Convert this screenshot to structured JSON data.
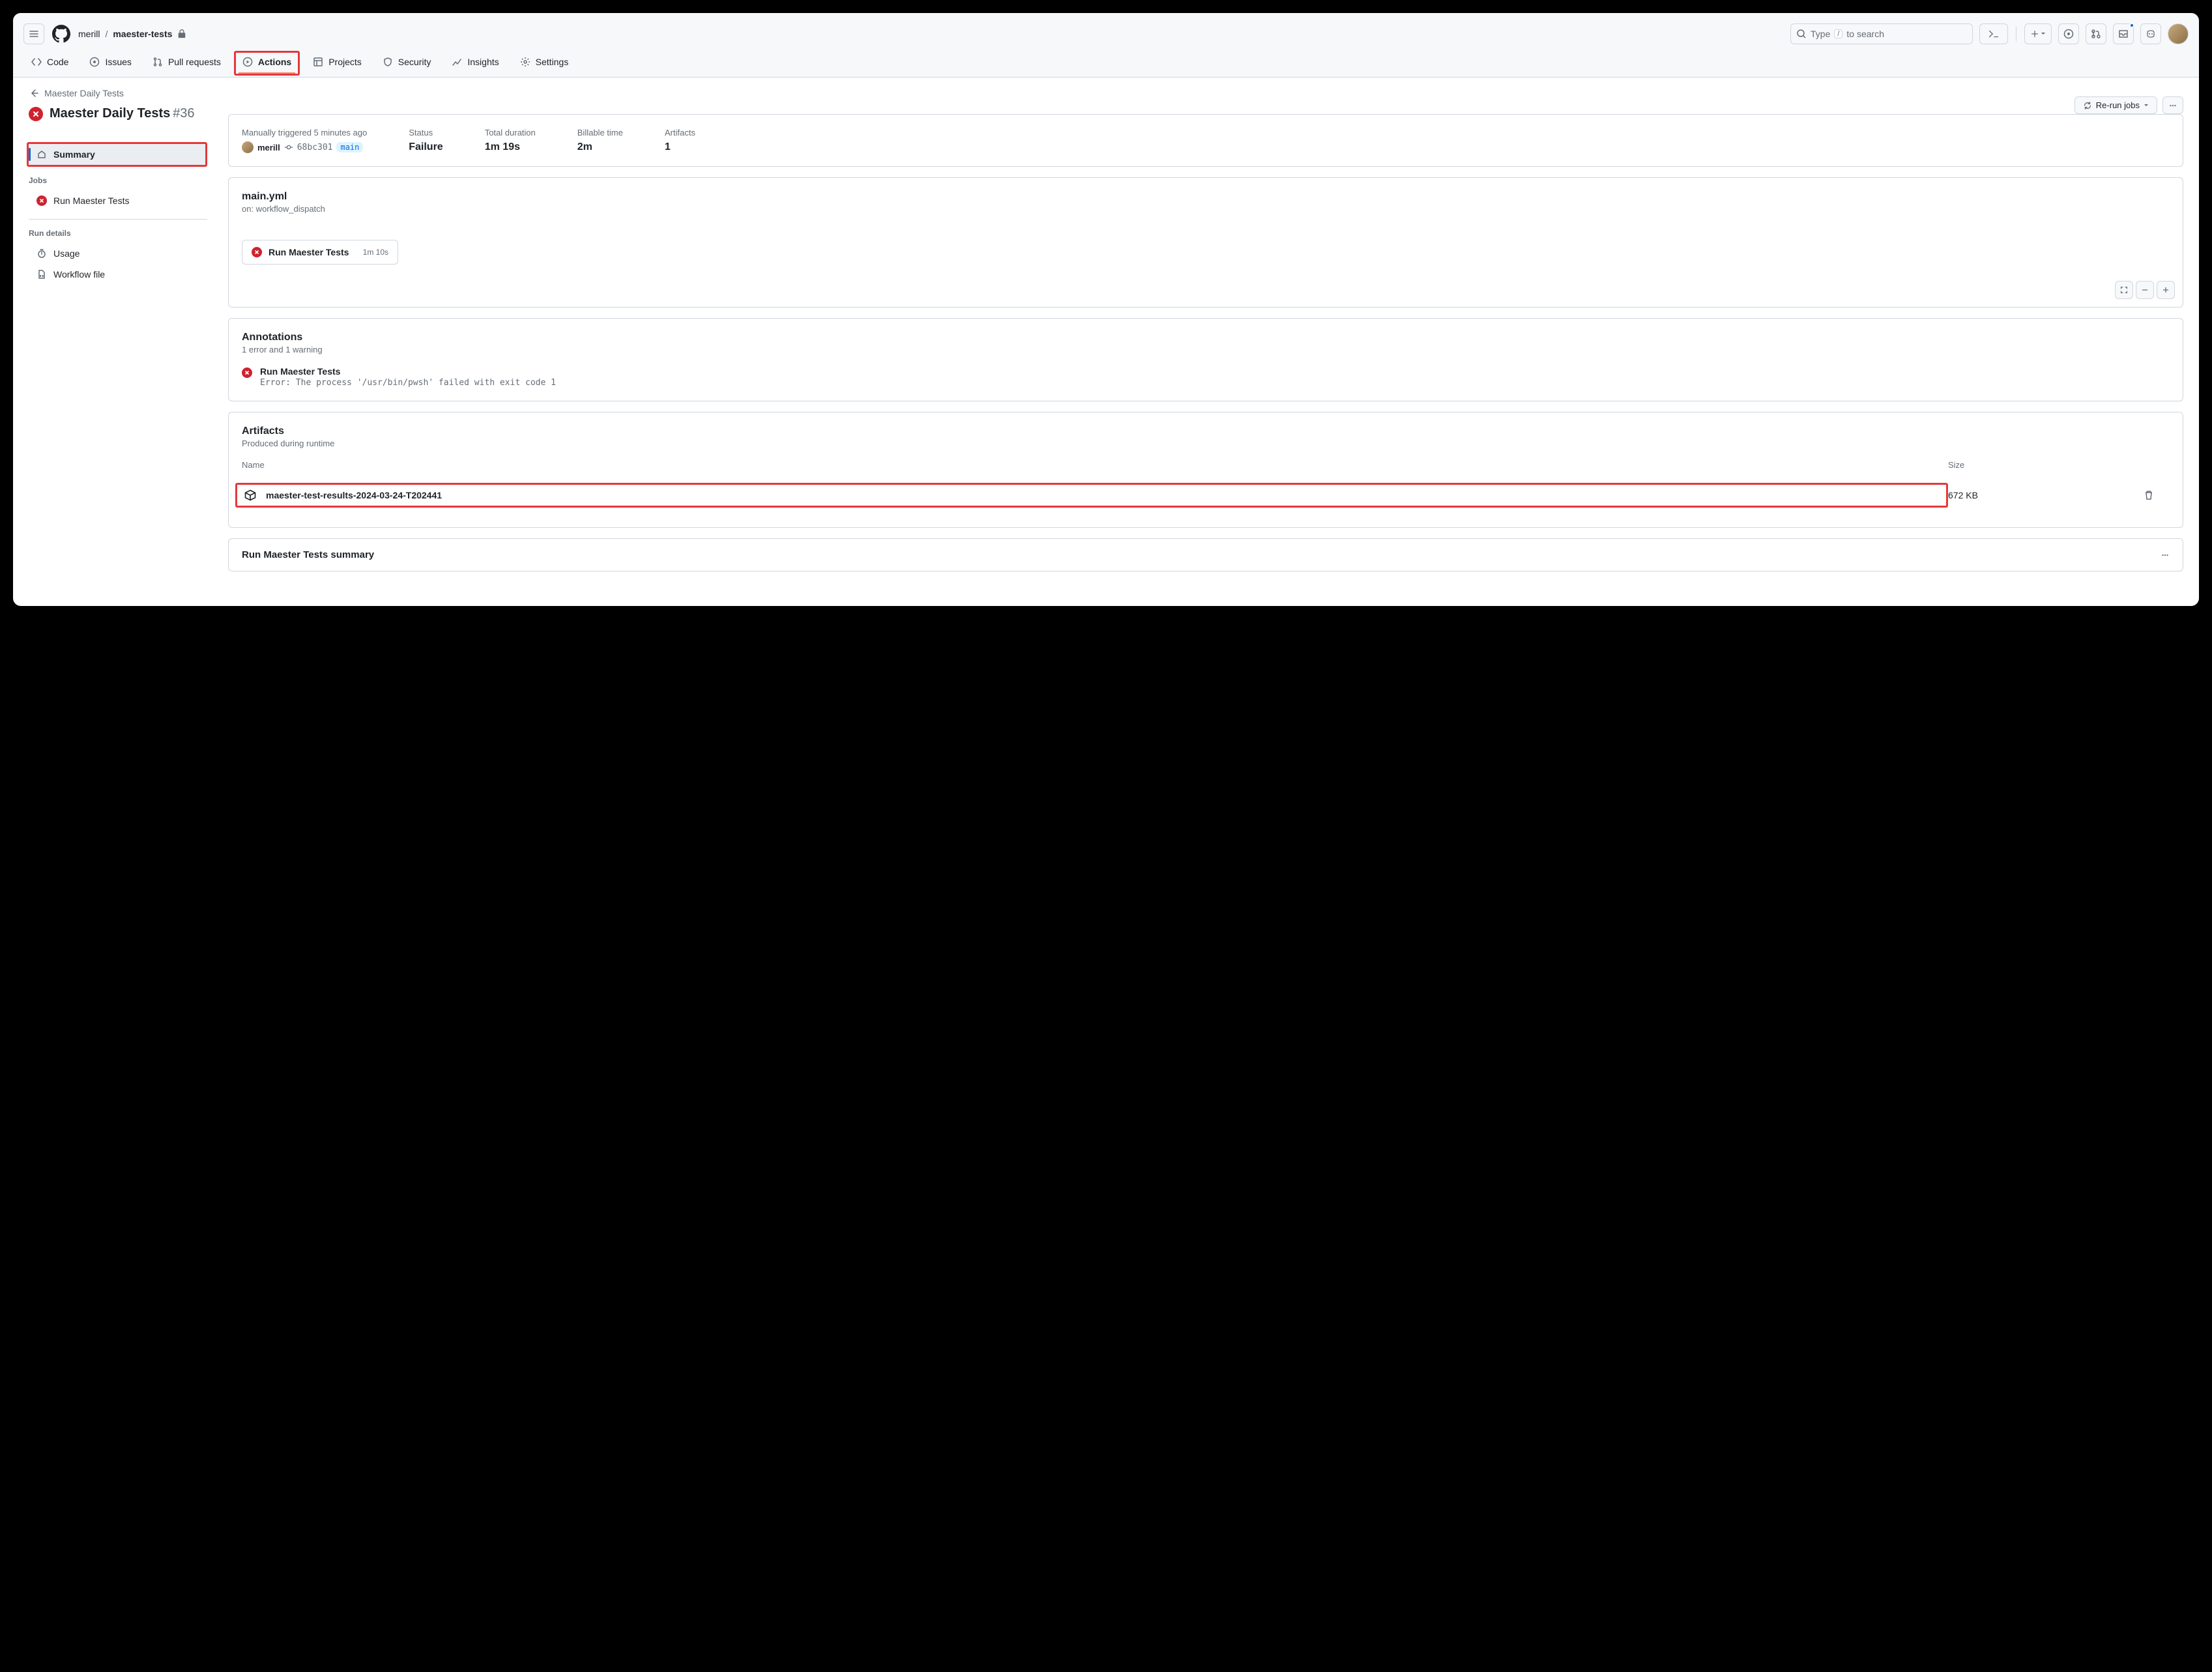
{
  "breadcrumb": {
    "owner": "merill",
    "repo": "maester-tests"
  },
  "search": {
    "placeholder_before": "Type",
    "kbd": "/",
    "placeholder_after": "to search"
  },
  "tabs": {
    "code": "Code",
    "issues": "Issues",
    "pulls": "Pull requests",
    "actions": "Actions",
    "projects": "Projects",
    "security": "Security",
    "insights": "Insights",
    "settings": "Settings"
  },
  "backlink": "Maester Daily Tests",
  "run": {
    "title": "Maester Daily Tests",
    "number": "#36"
  },
  "sidebar": {
    "summary": "Summary",
    "jobs_label": "Jobs",
    "job1": "Run Maester Tests",
    "details_label": "Run details",
    "usage": "Usage",
    "workflow_file": "Workflow file"
  },
  "actions_bar": {
    "rerun": "Re-run jobs"
  },
  "meta": {
    "triggered_text": "Manually triggered 5 minutes ago",
    "actor": "merill",
    "commit": "68bc301",
    "branch": "main",
    "status_label": "Status",
    "status_value": "Failure",
    "duration_label": "Total duration",
    "duration_value": "1m 19s",
    "billable_label": "Billable time",
    "billable_value": "2m",
    "artifacts_label": "Artifacts",
    "artifacts_value": "1"
  },
  "workflow": {
    "file": "main.yml",
    "on": "on: workflow_dispatch",
    "job_name": "Run Maester Tests",
    "job_dur": "1m 10s"
  },
  "annotations": {
    "title": "Annotations",
    "subtitle": "1 error and 1 warning",
    "item_name": "Run Maester Tests",
    "item_msg": "Error: The process '/usr/bin/pwsh' failed with exit code 1"
  },
  "artifacts": {
    "title": "Artifacts",
    "subtitle": "Produced during runtime",
    "col_name": "Name",
    "col_size": "Size",
    "row_name": "maester-test-results-2024-03-24-T202441",
    "row_size": "672 KB"
  },
  "summary_card": {
    "title": "Run Maester Tests summary"
  }
}
